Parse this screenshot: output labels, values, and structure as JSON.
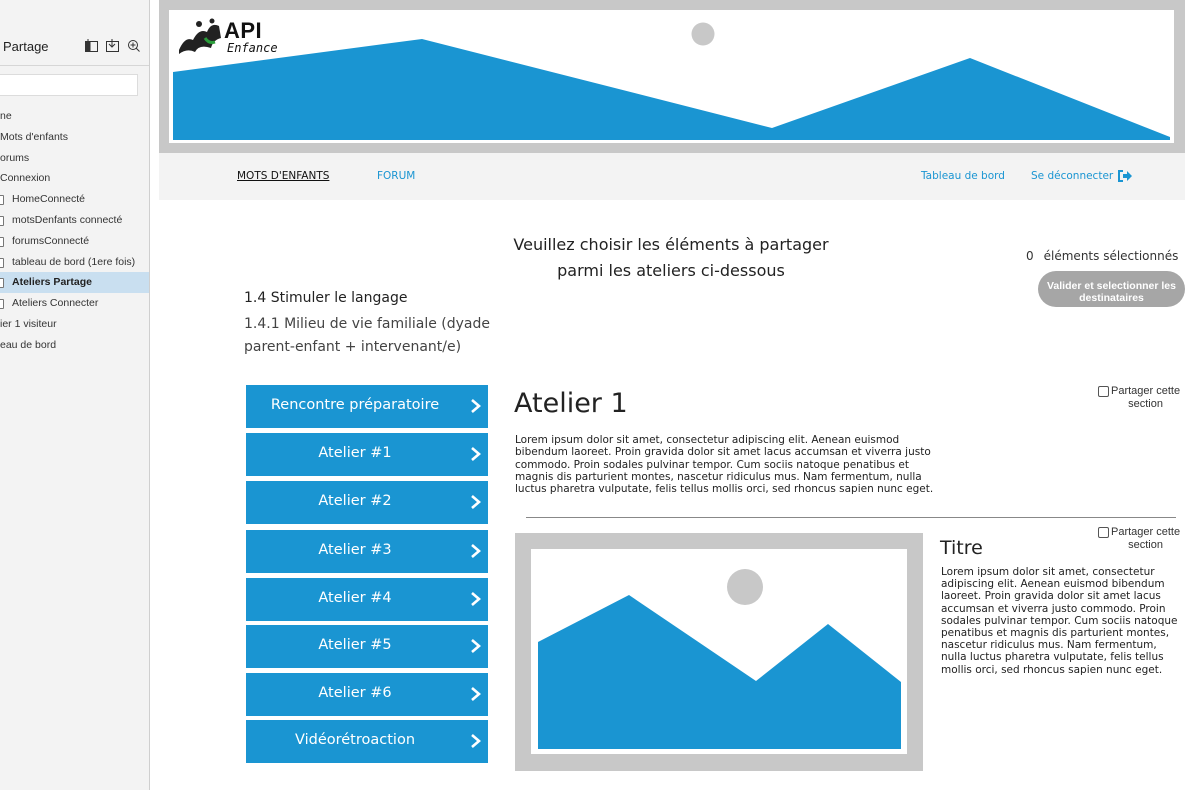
{
  "sidebar": {
    "title": "Partage",
    "icons": [
      "new-page-icon",
      "import-icon",
      "add-folder-icon"
    ],
    "items": [
      {
        "label": "ne",
        "indent": 0,
        "has_page_icon": false,
        "active": false
      },
      {
        "label": "Mots d'enfants",
        "indent": 0,
        "has_page_icon": false,
        "active": false
      },
      {
        "label": "orums",
        "indent": 0,
        "has_page_icon": false,
        "active": false
      },
      {
        "label": "Connexion",
        "indent": 0,
        "has_page_icon": false,
        "active": false
      },
      {
        "label": "HomeConnecté",
        "indent": 1,
        "has_page_icon": true,
        "active": false
      },
      {
        "label": "motsDenfants connecté",
        "indent": 1,
        "has_page_icon": true,
        "active": false
      },
      {
        "label": "forumsConnecté",
        "indent": 1,
        "has_page_icon": true,
        "active": false
      },
      {
        "label": "tableau de bord (1ere fois)",
        "indent": 1,
        "has_page_icon": true,
        "active": false
      },
      {
        "label": "Ateliers Partage",
        "indent": 1,
        "has_page_icon": true,
        "active": true
      },
      {
        "label": "Ateliers Connecter",
        "indent": 1,
        "has_page_icon": true,
        "active": false
      },
      {
        "label": "ier 1 visiteur",
        "indent": 0,
        "has_page_icon": false,
        "active": false
      },
      {
        "label": "eau de bord",
        "indent": 0,
        "has_page_icon": false,
        "active": false
      }
    ]
  },
  "banner": {
    "logo_api": "API",
    "logo_enfance": "Enfance",
    "accent": "#1a95d2",
    "frame_color": "#c8c8c8"
  },
  "nav": {
    "mots": "MOTS D'ENFANTS",
    "forum": "FORUM",
    "tableau": "Tableau de bord",
    "logout": "Se déconnecter"
  },
  "main": {
    "heading_line1": "Veuillez choisir les éléments à partager",
    "heading_line2": "parmi les ateliers ci-dessous",
    "selected_count": "0",
    "selected_label": "éléments sélectionnés",
    "validate_line1": "Valider et selectionner les",
    "validate_line2": "destinataires",
    "section_title": "1.4 Stimuler le langage",
    "section_sub": "1.4.1 Milieu de vie familiale (dyade parent-enfant + intervenant/e)",
    "atelier_buttons": [
      "Rencontre préparatoire",
      "Atelier #1",
      "Atelier #2",
      "Atelier #3",
      "Atelier #4",
      "Atelier #5",
      "Atelier #6",
      "Vidéorétroaction"
    ],
    "atelier_heading": "Atelier 1",
    "atelier_text": "Lorem ipsum dolor sit amet, consectetur adipiscing elit. Aenean euismod bibendum laoreet. Proin gravida dolor sit amet lacus accumsan et viverra justo commodo. Proin sodales pulvinar tempor. Cum sociis natoque penatibus et magnis dis parturient montes, nascetur ridiculus mus. Nam fermentum, nulla luctus pharetra vulputate, felis tellus mollis orci, sed rhoncus sapien nunc eget.",
    "share_line1": "Partager cette",
    "share_line2": "section",
    "titre": "Titre",
    "titre_text": "Lorem ipsum dolor sit amet, consectetur adipiscing elit. Aenean euismod bibendum laoreet. Proin gravida dolor sit amet lacus accumsan et viverra justo commodo. Proin sodales pulvinar tempor. Cum sociis natoque penatibus et magnis dis parturient montes, nascetur ridiculus mus. Nam fermentum, nulla luctus pharetra vulputate, felis tellus mollis orci, sed rhoncus sapien nunc eget."
  }
}
